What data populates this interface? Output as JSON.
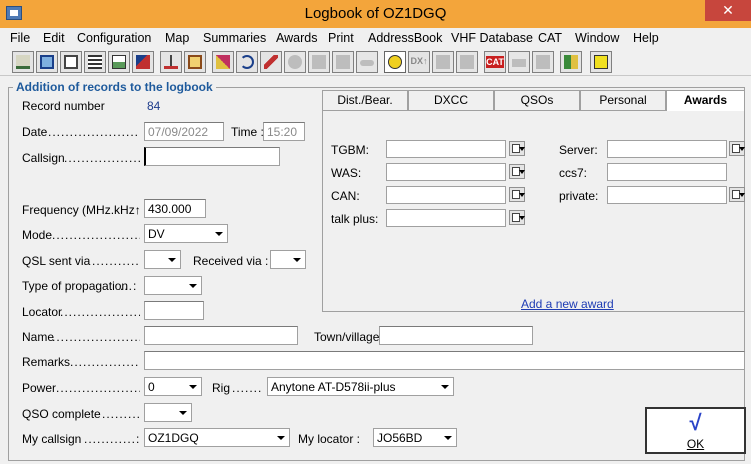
{
  "window": {
    "title": "Logbook of OZ1DGQ",
    "close": "✕"
  },
  "menu": [
    "File",
    "Edit",
    "Configuration",
    "Map",
    "Summaries",
    "Awards",
    "Print",
    "AddressBook",
    "VHF Database",
    "CAT",
    "Window",
    "Help"
  ],
  "toolbar": {
    "dx_label": "DX↑",
    "cat_label": "CAT"
  },
  "form": {
    "legend": "Addition of records to the logbook",
    "record_number_label": "Record number",
    "record_number": "84",
    "date_label": "Date",
    "date_value": "07/09/2022",
    "time_label": "Time :",
    "time_value": "15:20",
    "callsign_label": "Callsign",
    "callsign_value": "",
    "frequency_label": "Frequency (MHz.kHz↑",
    "frequency_value": "430.000",
    "mode_label": "Mode",
    "mode_value": "DV",
    "qsl_sent_label": "QSL sent via",
    "received_via_label": "Received via :",
    "propagation_label": "Type of propagation",
    "locator_label": "Locator",
    "name_label": "Name",
    "town_label": "Town/village",
    "remarks_label": "Remarks",
    "power_label": "Power",
    "power_value": "0",
    "rig_label": "Rig",
    "rig_value": "Anytone AT-D578ii-plus",
    "qso_complete_label": "QSO complete",
    "my_callsign_label": "My callsign",
    "my_callsign_value": "OZ1DGQ",
    "my_locator_label": "My locator :",
    "my_locator_value": "JO56BD"
  },
  "tabs": [
    "Dist./Bear.",
    "DXCC",
    "QSOs",
    "Personal",
    "Awards"
  ],
  "awards": {
    "left": [
      "TGBM:",
      "WAS:",
      "CAN:",
      "talk plus:"
    ],
    "right": [
      "Server:",
      "ccs7:",
      "private:"
    ],
    "add_link": "Add a new award"
  },
  "ok": {
    "check": "√",
    "label": "OK"
  }
}
